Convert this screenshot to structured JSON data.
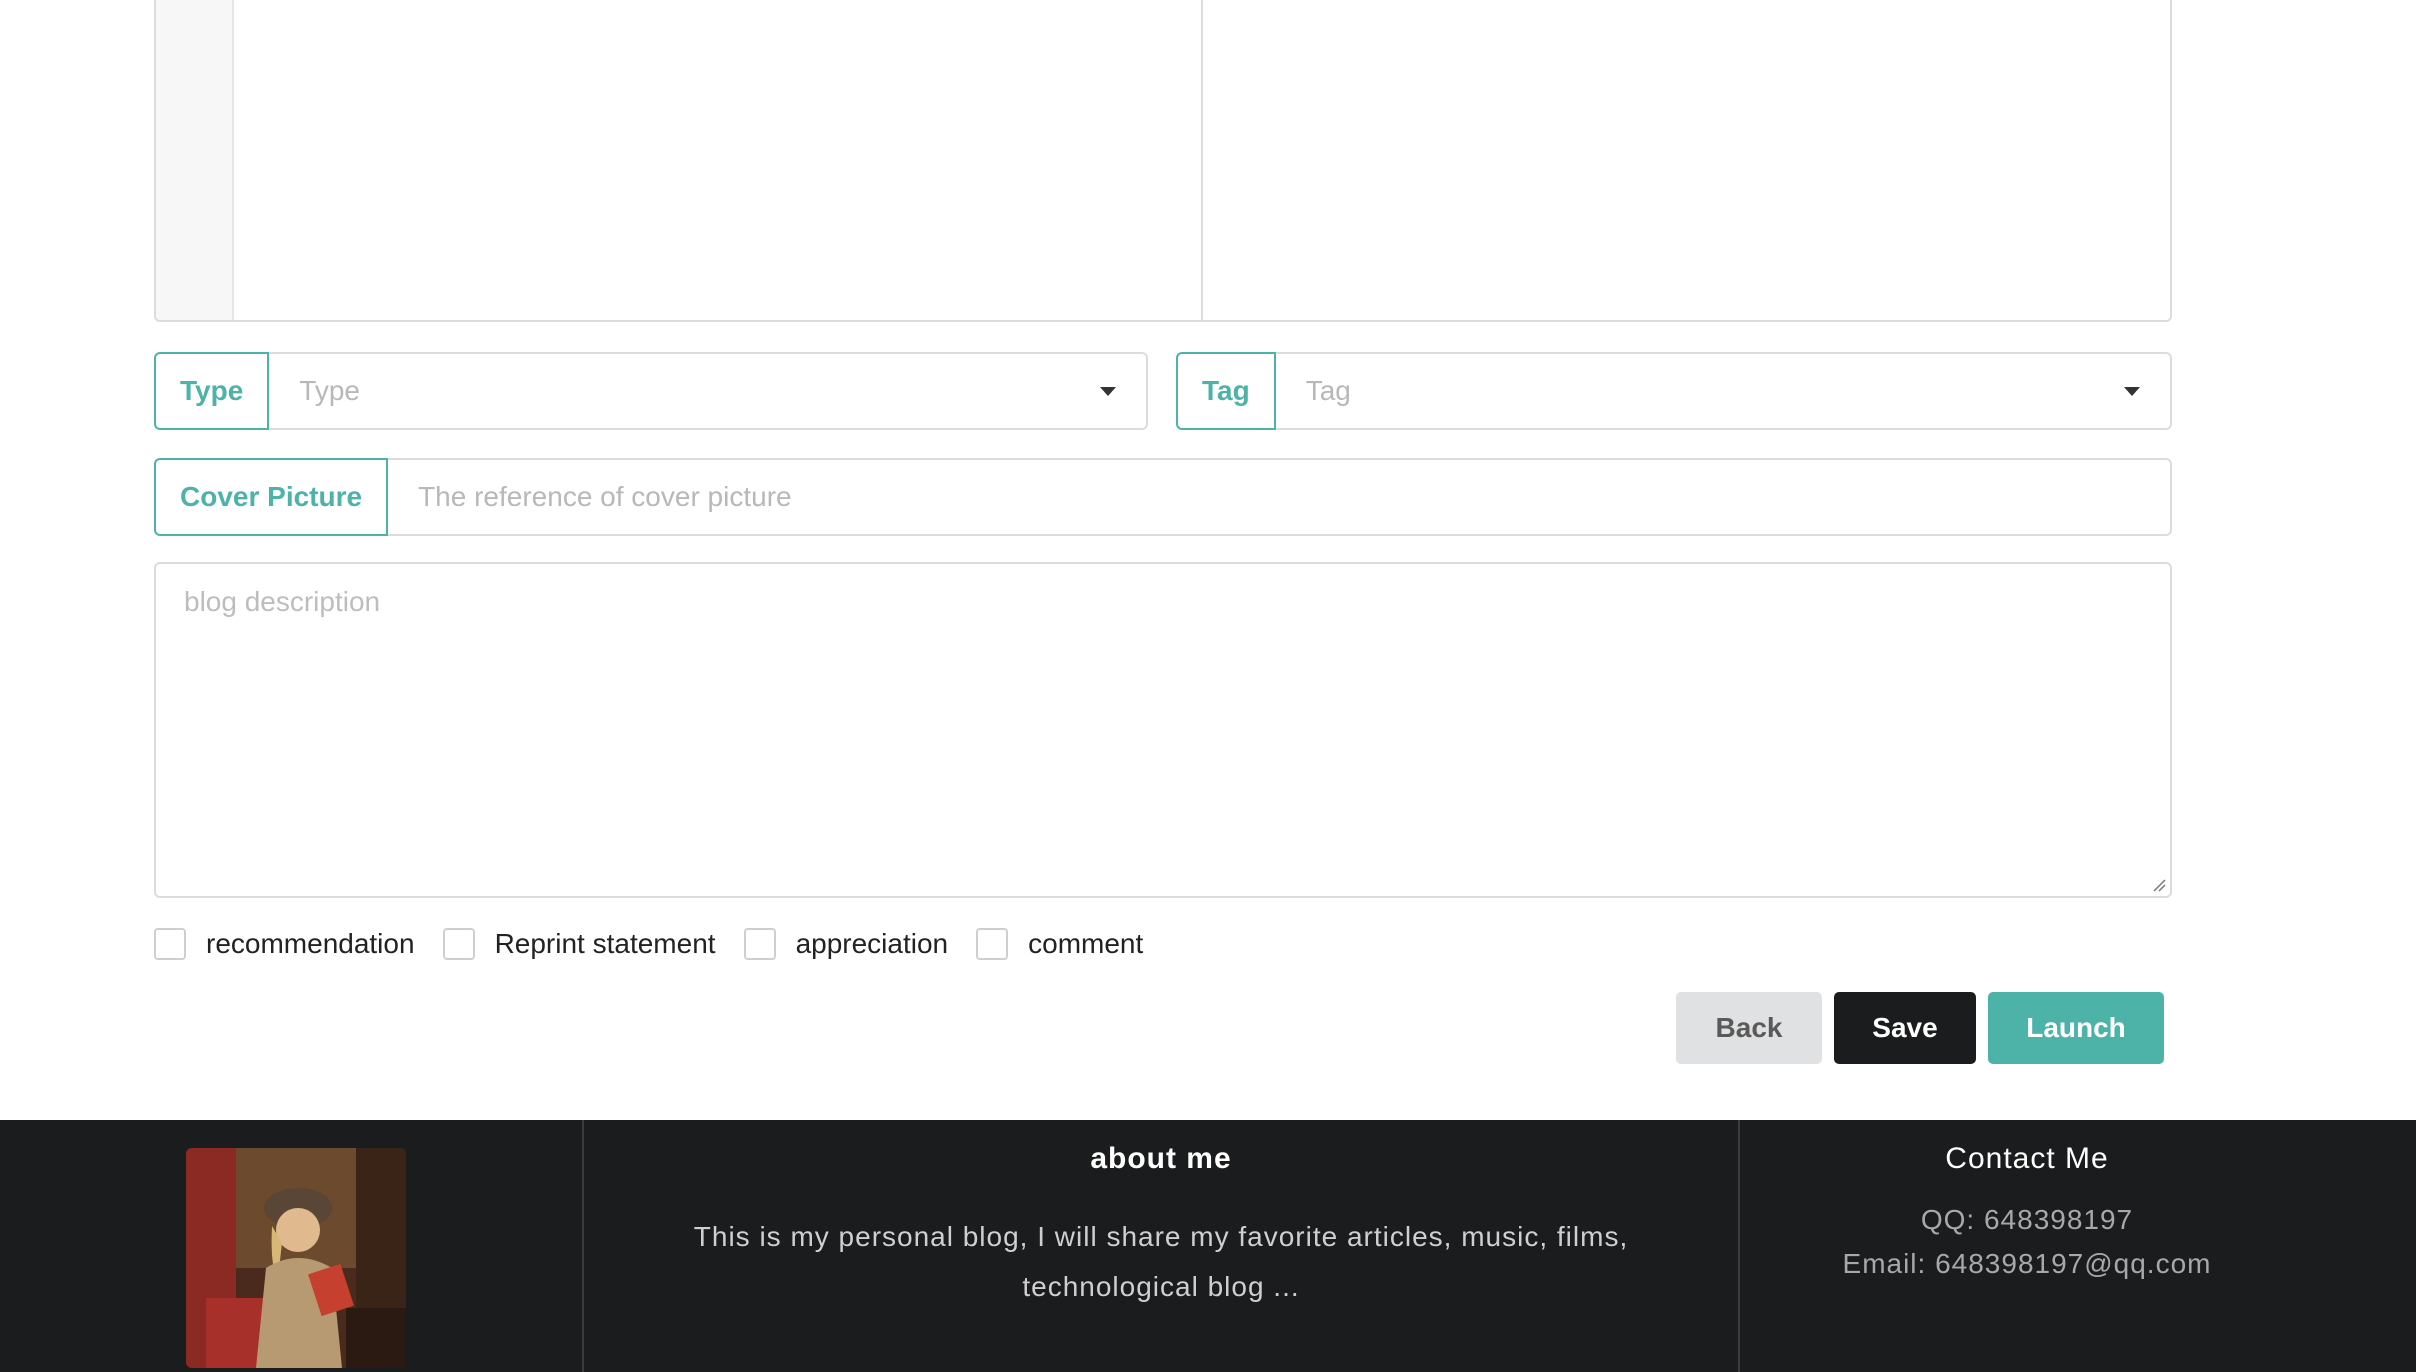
{
  "form": {
    "type": {
      "label": "Type",
      "placeholder": "Type"
    },
    "tag": {
      "label": "Tag",
      "placeholder": "Tag"
    },
    "cover": {
      "label": "Cover Picture",
      "placeholder": "The reference of cover picture"
    },
    "description": {
      "placeholder": "blog description"
    },
    "options": [
      {
        "label": "recommendation",
        "checked": false
      },
      {
        "label": "Reprint statement",
        "checked": false
      },
      {
        "label": "appreciation",
        "checked": false
      },
      {
        "label": "comment",
        "checked": false
      }
    ],
    "buttons": {
      "back": "Back",
      "save": "Save",
      "launch": "Launch"
    }
  },
  "footer": {
    "about_title": "about me",
    "about_text": "This is my personal blog, I will share my favorite articles, music, films, technological blog ...",
    "contact_title": "Contact Me",
    "qq": "QQ:  648398197",
    "email": "Email:  648398197@qq.com"
  },
  "colors": {
    "accent": "#4db3a9",
    "dark": "#1b1c1d",
    "back_button": "#e0e1e2"
  }
}
